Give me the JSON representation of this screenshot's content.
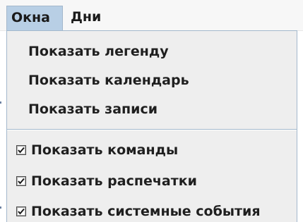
{
  "menubar": {
    "items": [
      {
        "label": "Окна",
        "active": true
      },
      {
        "label": "Дни",
        "active": false
      }
    ]
  },
  "dropdown": {
    "items": [
      {
        "label": "Показать легенду",
        "type": "action"
      },
      {
        "label": "Показать календарь",
        "type": "action"
      },
      {
        "label": "Показать записи",
        "type": "action"
      },
      {
        "label": "Показать команды",
        "type": "checkbox",
        "checked": true,
        "icon": "checkbox-checked-icon"
      },
      {
        "label": "Показать распечатки",
        "type": "checkbox",
        "checked": true,
        "icon": "checkbox-checked-icon"
      },
      {
        "label": "Показать системные события",
        "type": "checkbox",
        "checked": true,
        "icon": "checkbox-checked-icon"
      }
    ]
  },
  "colors": {
    "menubar_bg": "#f7f7f7",
    "active_menu_bg": "#b8cfe5",
    "dropdown_bg": "#eeeeee",
    "border": "#a3b8cc",
    "text": "#1f1f1f"
  }
}
